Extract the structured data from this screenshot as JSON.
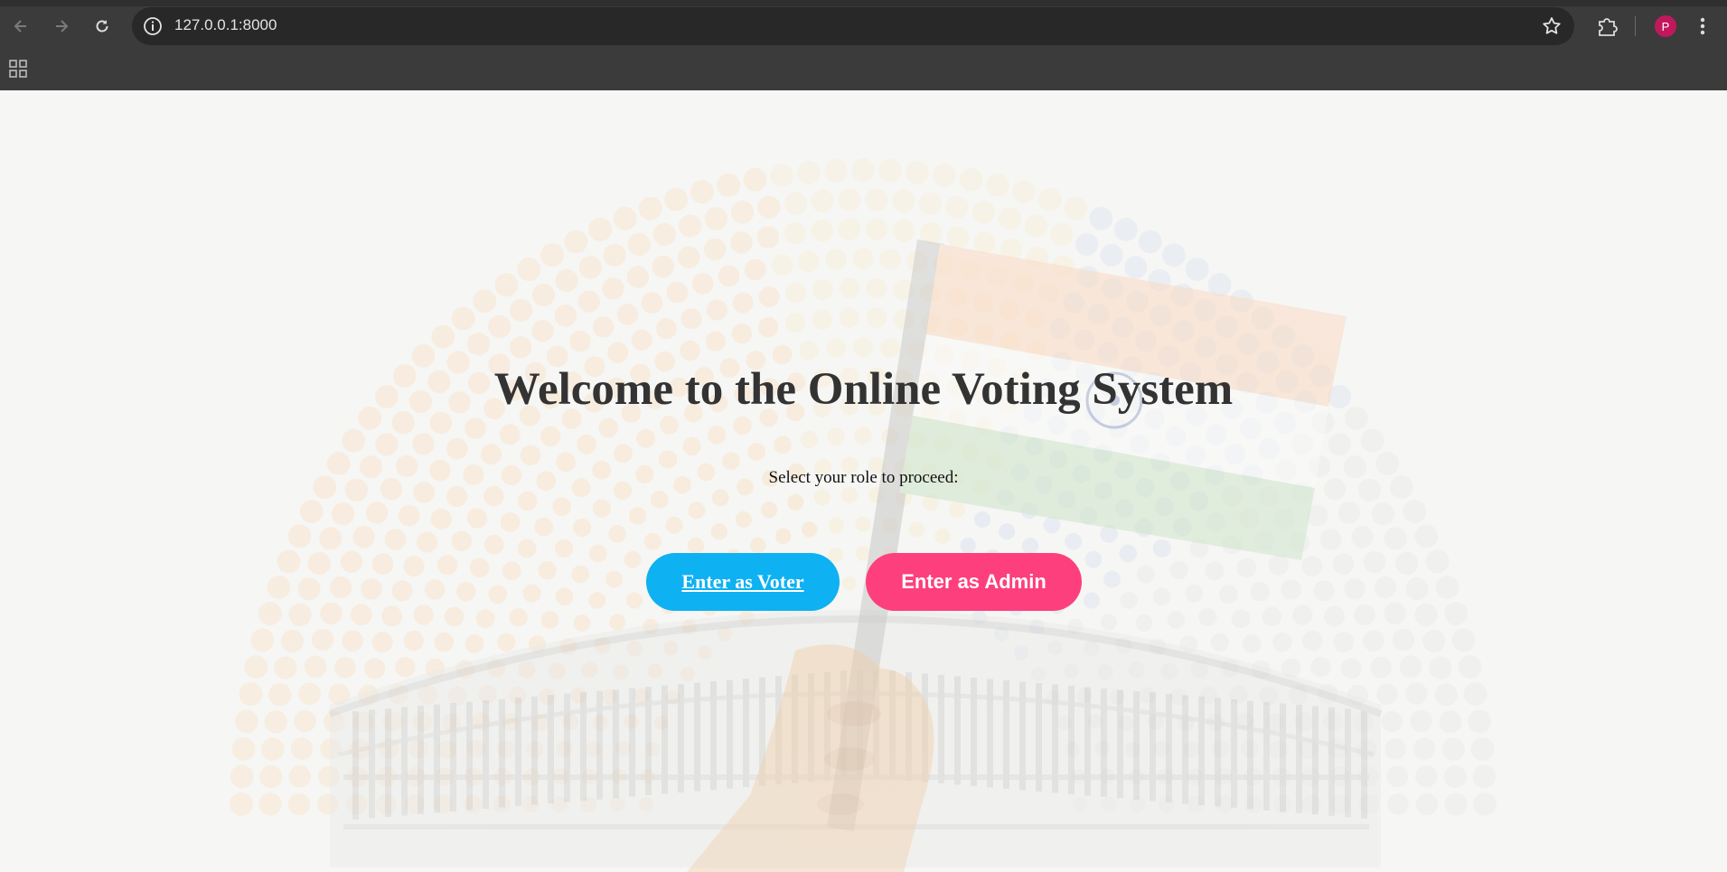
{
  "browser": {
    "url": "127.0.0.1:8000",
    "profile_initial": "P",
    "icons": {
      "back": "back-arrow-icon",
      "forward": "forward-arrow-icon",
      "reload": "reload-icon",
      "site_info": "info-icon",
      "bookmark": "star-icon",
      "extensions": "puzzle-icon",
      "menu": "kebab-menu-icon",
      "apps": "apps-grid-icon"
    }
  },
  "page": {
    "title": "Welcome to the Online Voting System",
    "subtitle": "Select your role to proceed:",
    "voter_button": "Enter as Voter",
    "admin_button": "Enter as Admin"
  },
  "colors": {
    "voter_button": "#0eb1f2",
    "admin_button": "#fe3f7d",
    "saffron": "#ff9933",
    "green": "#138808",
    "chakra_blue": "#1a3a9a"
  }
}
